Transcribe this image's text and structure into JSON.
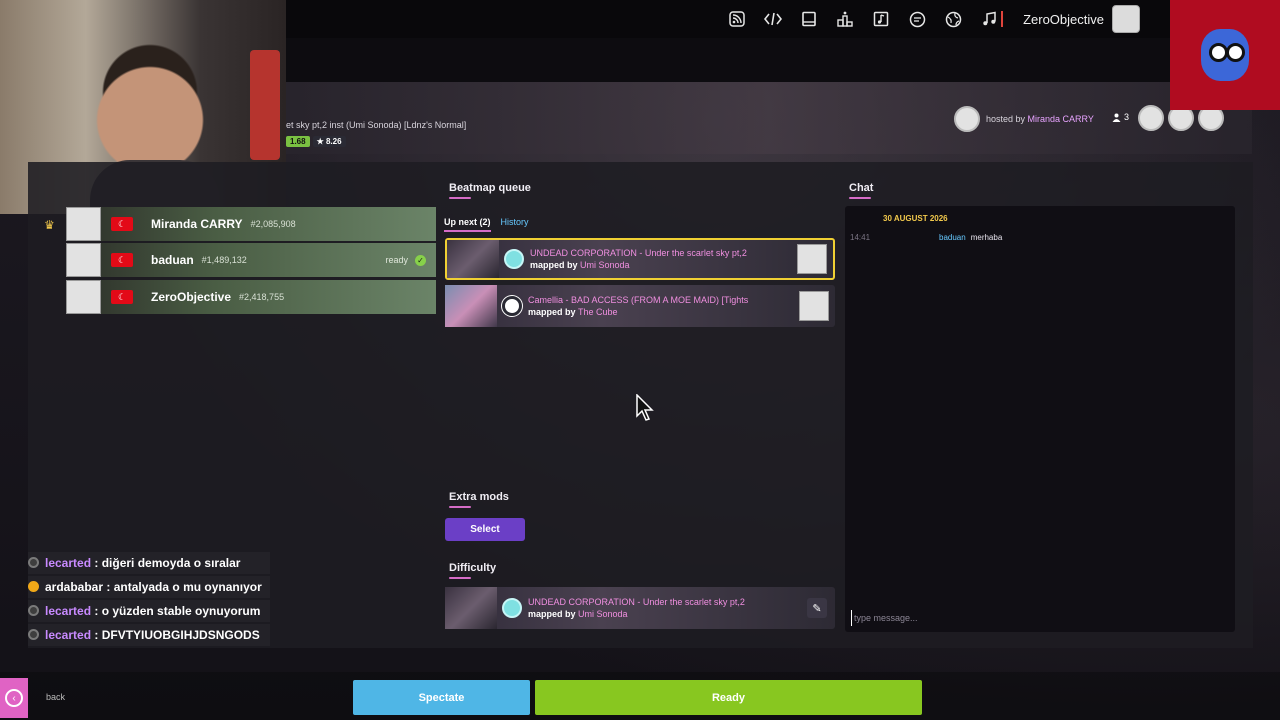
{
  "toolbar": {
    "icons": [
      "rss-icon",
      "code-icon",
      "book-icon",
      "ranking-icon",
      "beatmap-icon",
      "chat-icon",
      "globe-icon",
      "music-icon"
    ],
    "username": "ZeroObjective"
  },
  "room": {
    "beatmap_label": "et sky pt,2 inst (Umi Sonoda) [Ldnz's Normal]",
    "sr": "1.68",
    "star": "★ 8.26",
    "host_prefix": "hosted by ",
    "host_name": "Miranda CARRY",
    "participant_count": "3"
  },
  "players": [
    {
      "name": "Miranda CARRY",
      "rank": "#2,085,908",
      "status": "",
      "host": true
    },
    {
      "name": "baduan",
      "rank": "#1,489,132",
      "status": "ready",
      "host": false
    },
    {
      "name": "ZeroObjective",
      "rank": "#2,418,755",
      "status": "",
      "host": false
    }
  ],
  "queue": {
    "title": "Beatmap queue",
    "tab_up_next": "Up next (2)",
    "tab_history": "History",
    "items": [
      {
        "title": "UNDEAD CORPORATION - Under the scarlet sky pt,2",
        "mapper_prefix": "mapped by ",
        "mapper": "Umi Sonoda"
      },
      {
        "title": "Camellia - BAD ACCESS (FROM A MOE MAID) [Tights",
        "mapper_prefix": "mapped by ",
        "mapper": "The Cube"
      }
    ]
  },
  "extra_mods": {
    "title": "Extra mods",
    "button": "Select"
  },
  "difficulty": {
    "title": "Difficulty",
    "item": {
      "title": "UNDEAD CORPORATION - Under the scarlet sky pt,2",
      "mapper_prefix": "mapped by ",
      "mapper": "Umi Sonoda"
    }
  },
  "chat": {
    "title": "Chat",
    "date": "30 AUGUST 2026",
    "messages": [
      {
        "time": "14:41",
        "user": "baduan",
        "text": "merhaba"
      }
    ],
    "placeholder": "type message..."
  },
  "stream_chat": [
    {
      "user": "lecarted",
      "text": ": diğeri demoyda o sıralar",
      "badge": "gray"
    },
    {
      "user": "ardababar",
      "text": ": antalyada o mu oynanıyor",
      "badge": "yellow"
    },
    {
      "user": "lecarted",
      "text": ": o yüzden stable oynuyorum",
      "badge": "gray"
    },
    {
      "user": "lecarted",
      "text": ": DFVTYIUOBGIHJDSNGODS",
      "badge": "gray"
    }
  ],
  "footer": {
    "back": "back",
    "spectate": "Spectate",
    "ready": "Ready"
  },
  "colors": {
    "accent_pink": "#d56cc7",
    "ready_green": "#88c720",
    "spectate_blue": "#4fb6e6",
    "selected_border": "#f0d033",
    "select_purple": "#6b3fc6"
  }
}
